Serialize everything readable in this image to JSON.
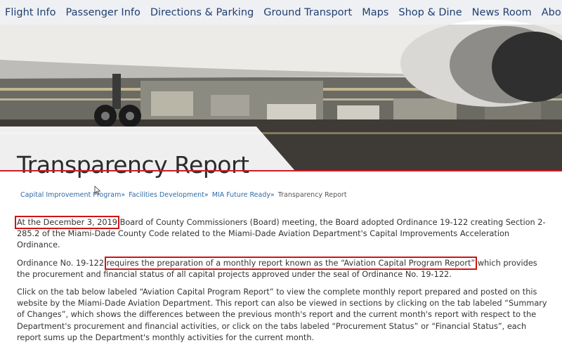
{
  "nav": {
    "items": [
      "Flight Info",
      "Passenger Info",
      "Directions & Parking",
      "Ground Transport",
      "Maps",
      "Shop & Dine",
      "News Room",
      "About Us"
    ]
  },
  "page": {
    "title": "Transparency Report"
  },
  "breadcrumb": {
    "links": [
      "Capital Improvement Program",
      "Facilities Development",
      "MIA Future Ready"
    ],
    "separator": "»",
    "current": "Transparency Report"
  },
  "content": {
    "p1_highlight": "At the December 3, 2019",
    "p1_rest": " Board of County Commissioners (Board) meeting, the Board adopted Ordinance 19-122 creating Section 2-285.2 of the Miami-Dade County Code related to the Miami-Dade Aviation Department's Capital Improvements Acceleration Ordinance.",
    "p2_start": "Ordinance No. 19-122 ",
    "p2_highlight": "requires the preparation of a monthly report known as the “Aviation Capital Program Report”",
    "p2_rest": " which provides the procurement and financial status of all capital projects approved under the seal of Ordinance No. 19-122.",
    "p3": "Click on the tab below labeled “Aviation Capital Program Report” to view the complete monthly report prepared and posted on this website by the Miami-Dade Aviation Department. This report can also be viewed in sections by clicking on the tab labeled  “Summary of Changes”, which shows the differences between the previous month's report and the current month's report with respect to the Department's procurement and financial activities, or click on the tabs labeled “Procurement Status” or “Financial Status”, each report sums up the Department's monthly activities for the current month."
  },
  "colors": {
    "nav_text": "#1f3f72",
    "accent_red": "#c81e2a",
    "link": "#2e6aa6"
  }
}
